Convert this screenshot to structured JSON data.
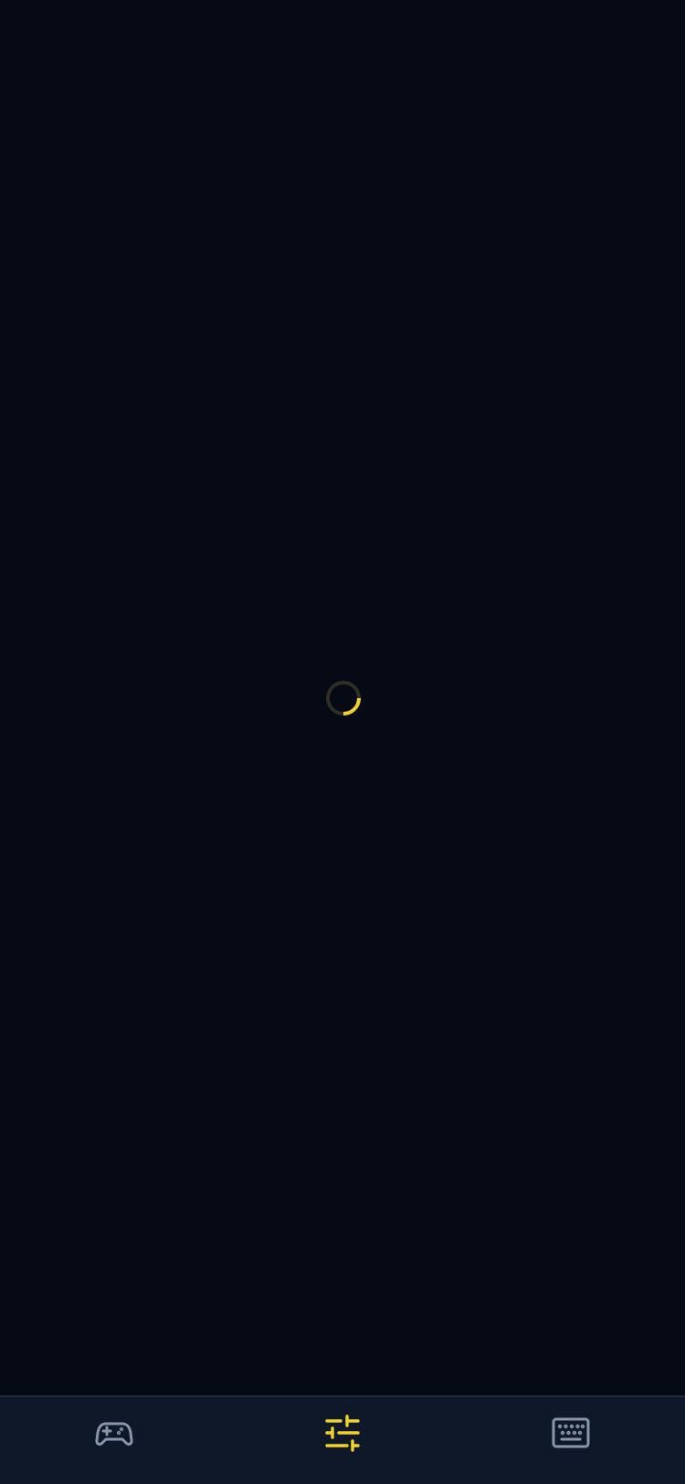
{
  "loading": {
    "spinner_icon": "loading-spinner-icon",
    "track_color": "#2e2f24",
    "accent_color": "#f0d22a"
  },
  "bottom_nav": {
    "background_color": "#0f1829",
    "inactive_color": "#8796ad",
    "active_color": "#f0d22a",
    "active_index": 1,
    "items": [
      {
        "icon": "gamepad-icon",
        "active": false
      },
      {
        "icon": "sliders-icon",
        "active": true
      },
      {
        "icon": "keyboard-icon",
        "active": false
      }
    ]
  }
}
